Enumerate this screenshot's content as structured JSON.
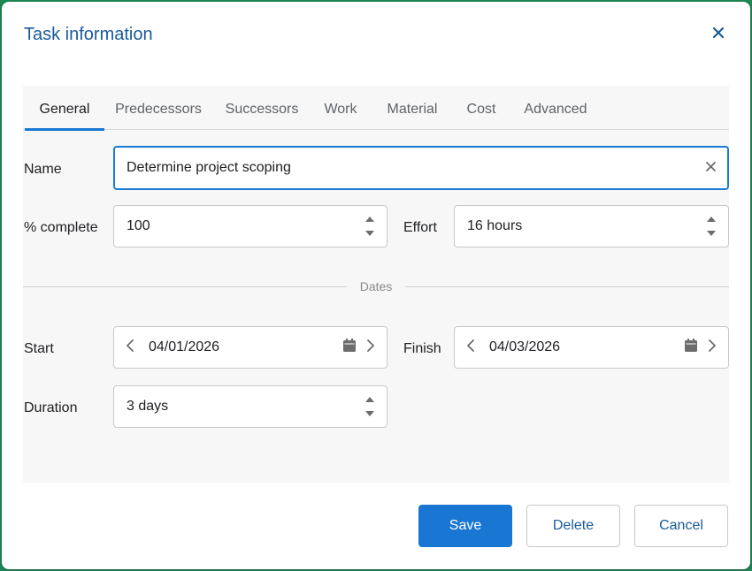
{
  "dialog": {
    "title": "Task information",
    "close_icon": "close-icon"
  },
  "tabs": [
    {
      "label": "General",
      "active": true
    },
    {
      "label": "Predecessors"
    },
    {
      "label": "Successors"
    },
    {
      "label": "Work"
    },
    {
      "label": "Material"
    },
    {
      "label": "Cost"
    },
    {
      "label": "Advanced"
    }
  ],
  "general": {
    "name_label": "Name",
    "name_value": "Determine project scoping",
    "percent_label": "% complete",
    "percent_value": "100",
    "effort_label": "Effort",
    "effort_value": "16 hours",
    "dates_divider": "Dates",
    "start_label": "Start",
    "start_value": "04/01/2026",
    "finish_label": "Finish",
    "finish_value": "04/03/2026",
    "duration_label": "Duration",
    "duration_value": "3 days"
  },
  "footer": {
    "save_label": "Save",
    "delete_label": "Delete",
    "cancel_label": "Cancel"
  },
  "colors": {
    "accent": "#1976d2",
    "title": "#1a5b99",
    "backdrop": "#1f8a57"
  }
}
